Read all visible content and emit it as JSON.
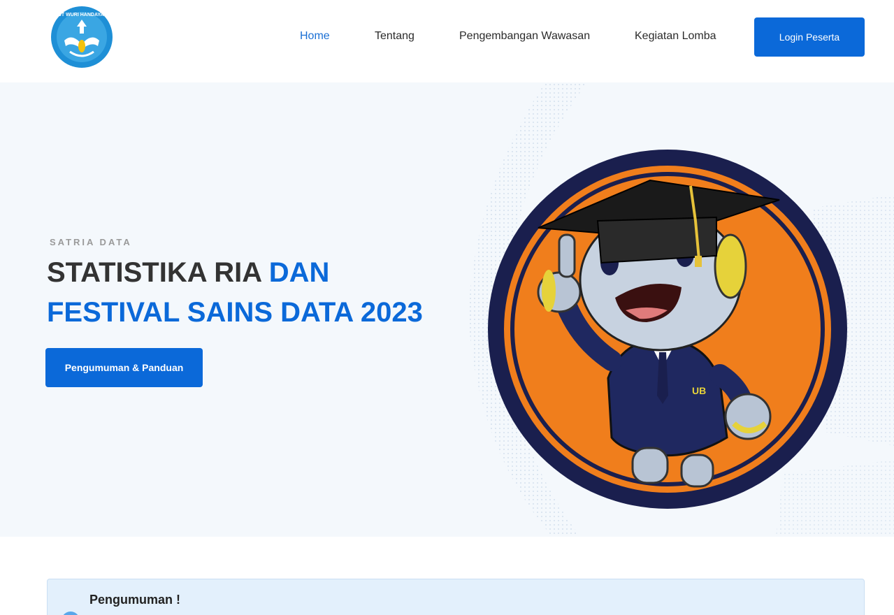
{
  "header": {
    "logo_icon": "tut-wuri-handayani-logo",
    "logo_text": "TUT WURI HANDAYANI",
    "nav": [
      {
        "label": "Home",
        "active": true
      },
      {
        "label": "Tentang",
        "active": false
      },
      {
        "label": "Pengembangan Wawasan",
        "active": false
      },
      {
        "label": "Kegiatan Lomba",
        "active": false
      }
    ],
    "login_label": "Login Peserta"
  },
  "hero": {
    "eyebrow": "SATRIA DATA",
    "title_dark": "STATISTIKA RIA ",
    "title_blue": "DAN FESTIVAL SAINS DATA 2023",
    "cta_label": "Pengumuman & Panduan",
    "illustration_icon": "graduate-robot-mascot",
    "mascot_badge": "UB"
  },
  "announcement": {
    "title": "Pengumuman !",
    "icon": "info-icon"
  },
  "colors": {
    "primary": "#0b69d9",
    "hero_bg": "#f4f8fc",
    "circle_orange": "#f07e1c",
    "circle_navy": "#1a1f4e",
    "announce_bg": "#e3f0fc"
  }
}
